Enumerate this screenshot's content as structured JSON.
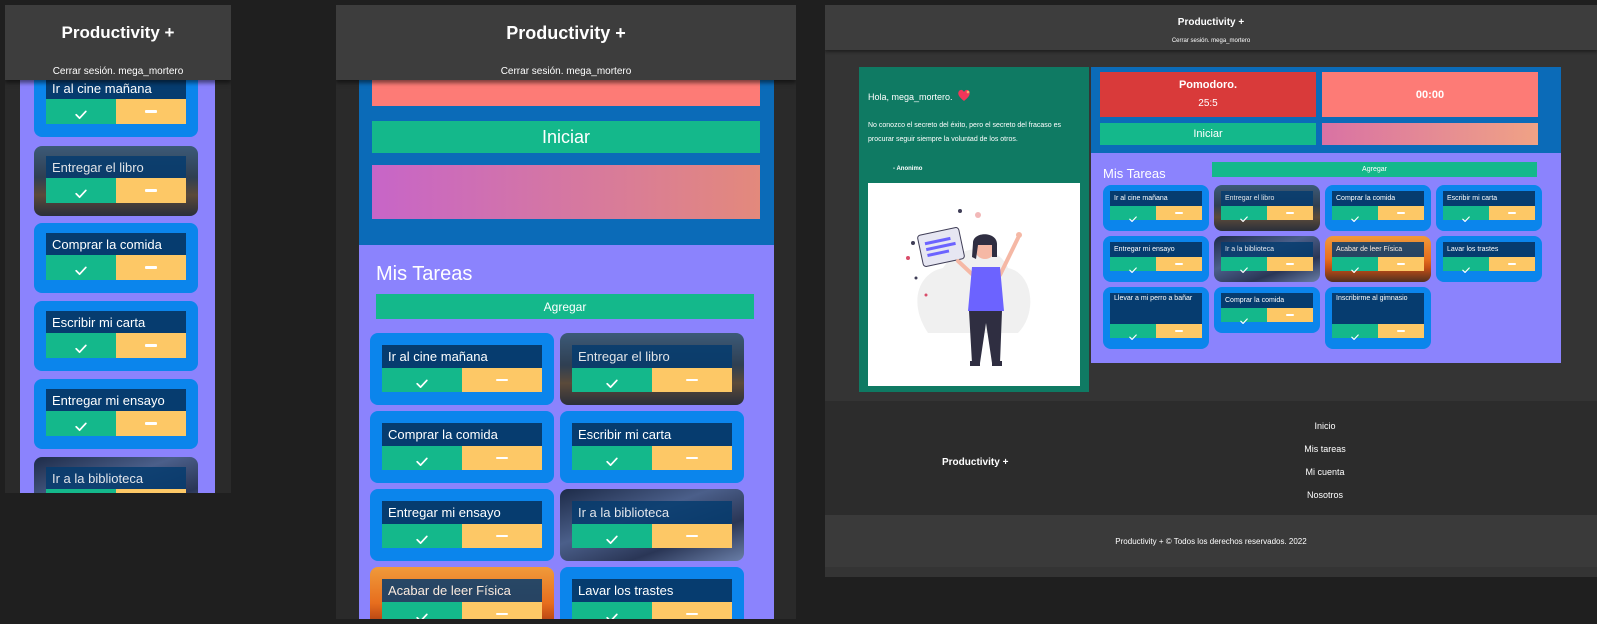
{
  "app": {
    "brand": "Productivity +",
    "logout": "Cerrar sesión. mega_mortero"
  },
  "tasks": [
    "Ir al cine mañana",
    "Entregar el libro",
    "Comprar la comida",
    "Escribir mi carta",
    "Entregar mi ensayo",
    "Ir a la biblioteca",
    "Acabar de leer Física",
    "Lavar los trastes",
    "Llevar a mi perro a bañar",
    "Comprar la comida",
    "Inscribirme al gimnasio"
  ],
  "tasks_title": "Mis Tareas",
  "add_label": "Agregar",
  "pomodoro": {
    "start_label": "Iniciar",
    "title": "Pomodoro.",
    "ratio": "25:5",
    "timer": "00:00"
  },
  "greeting": {
    "hello": "Hola, mega_mortero.",
    "quote": "No conozco el secreto del éxito, pero el secreto del fracaso es procurar seguir siempre la voluntad de los otros.",
    "author": "- Anonimo"
  },
  "footer": {
    "links": [
      "Inicio",
      "Mis tareas",
      "Mi cuenta",
      "Nosotros"
    ],
    "copyright": "Productivity + © Todos los derechos reservados. 2022"
  },
  "icons": {
    "check": "check-icon",
    "minus": "minus-icon",
    "heart": "sparkle-heart-icon"
  },
  "colors": {
    "accent_green": "#14b88b",
    "yellow": "#fdc866",
    "purple": "#8b83fd",
    "blue": "#0b85ec",
    "dark_blue": "#063c6f",
    "red": "#d93a3a",
    "salmon": "#fd7b76"
  }
}
